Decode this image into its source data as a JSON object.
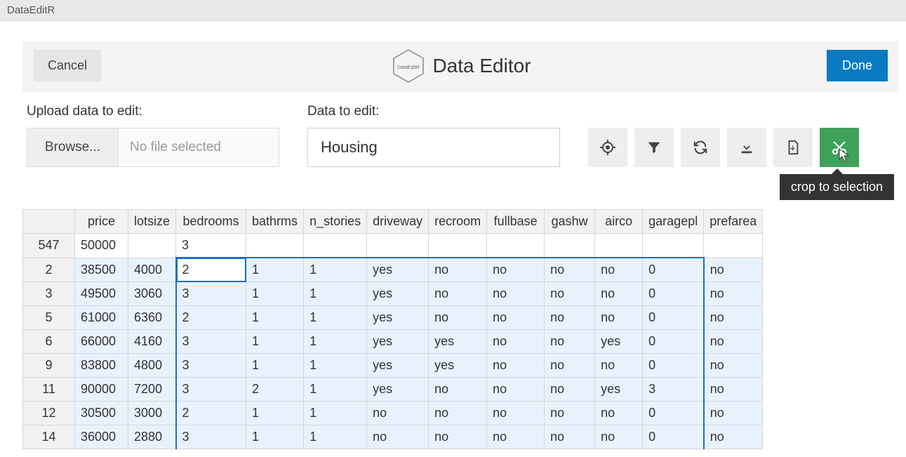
{
  "title_bar": {
    "app_name": "DataEditR"
  },
  "dialog": {
    "cancel_label": "Cancel",
    "title": "Data Editor",
    "logo_text": "DataEditR",
    "done_label": "Done"
  },
  "upload": {
    "label": "Upload data to edit:",
    "browse_label": "Browse...",
    "placeholder": "No file selected"
  },
  "data_select": {
    "label": "Data to edit:",
    "value": "Housing"
  },
  "toolbar": {
    "icons": [
      "target",
      "filter",
      "sync",
      "download",
      "save-file",
      "cut"
    ],
    "tooltip": "crop to selection"
  },
  "table": {
    "columns": [
      "",
      "price",
      "lotsize",
      "bedrooms",
      "bathrms",
      "n_stories",
      "driveway",
      "recroom",
      "fullbase",
      "gashw",
      "airco",
      "garagepl",
      "prefarea"
    ],
    "rows": [
      {
        "rownum": "547",
        "cells": [
          "50000",
          "",
          "3",
          "",
          "",
          "",
          "",
          "",
          "",
          "",
          "",
          ""
        ],
        "sel": false
      },
      {
        "rownum": "2",
        "cells": [
          "38500",
          "4000",
          "2",
          "1",
          "1",
          "yes",
          "no",
          "no",
          "no",
          "no",
          "0",
          "no"
        ],
        "sel": true,
        "sel_top": true,
        "active_col_index": 2
      },
      {
        "rownum": "3",
        "cells": [
          "49500",
          "3060",
          "3",
          "1",
          "1",
          "yes",
          "no",
          "no",
          "no",
          "no",
          "0",
          "no"
        ],
        "sel": true
      },
      {
        "rownum": "5",
        "cells": [
          "61000",
          "6360",
          "2",
          "1",
          "1",
          "yes",
          "no",
          "no",
          "no",
          "no",
          "0",
          "no"
        ],
        "sel": true
      },
      {
        "rownum": "6",
        "cells": [
          "66000",
          "4160",
          "3",
          "1",
          "1",
          "yes",
          "yes",
          "no",
          "no",
          "yes",
          "0",
          "no"
        ],
        "sel": true
      },
      {
        "rownum": "9",
        "cells": [
          "83800",
          "4800",
          "3",
          "1",
          "1",
          "yes",
          "yes",
          "no",
          "no",
          "no",
          "0",
          "no"
        ],
        "sel": true
      },
      {
        "rownum": "11",
        "cells": [
          "90000",
          "7200",
          "3",
          "2",
          "1",
          "yes",
          "no",
          "no",
          "no",
          "yes",
          "3",
          "no"
        ],
        "sel": true
      },
      {
        "rownum": "12",
        "cells": [
          "30500",
          "3000",
          "2",
          "1",
          "1",
          "no",
          "no",
          "no",
          "no",
          "no",
          "0",
          "no"
        ],
        "sel": true
      },
      {
        "rownum": "14",
        "cells": [
          "36000",
          "2880",
          "3",
          "1",
          "1",
          "no",
          "no",
          "no",
          "no",
          "no",
          "0",
          "no"
        ],
        "sel": true
      }
    ],
    "sel_col_start": 2,
    "sel_col_end": 10
  }
}
